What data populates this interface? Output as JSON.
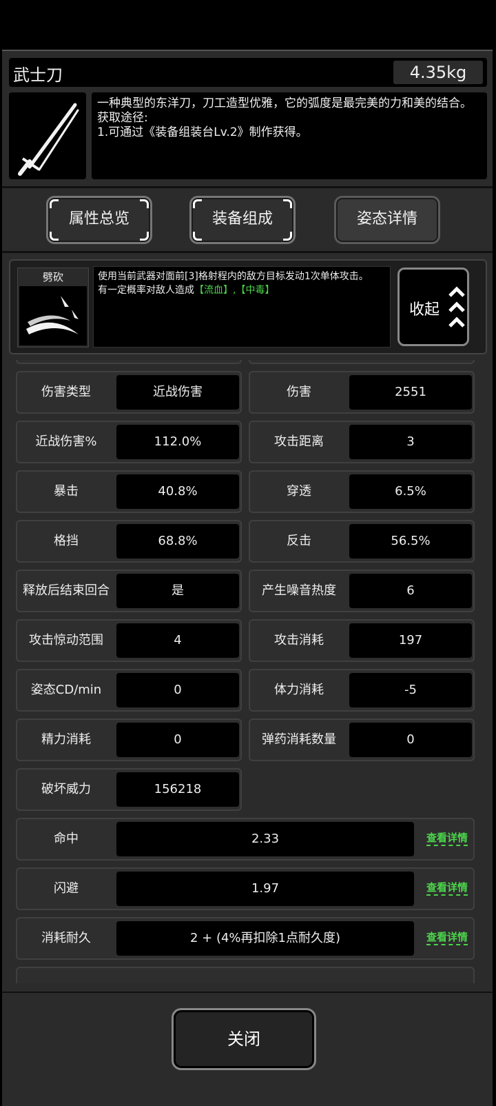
{
  "item": {
    "name": "武士刀",
    "weight": "4.35kg",
    "description_lines": [
      "一种典型的东洋刀，刀工造型优雅，它的弧度是最完美的力和美的结合。",
      "获取途径:",
      "1.可通过《装备组装台Lv.2》制作获得。"
    ]
  },
  "tabs": [
    {
      "label": "属性总览"
    },
    {
      "label": "装备组成"
    },
    {
      "label": "姿态详情"
    }
  ],
  "skill": {
    "name": "劈砍",
    "desc_line1": "使用当前武器对面前[3]格射程内的敌方目标发动1次单体攻击。",
    "desc_line2_prefix": "有一定概率对敌人造成",
    "desc_tag1": "【流血】",
    "desc_sep": ",",
    "desc_tag2": "【中毒】",
    "collapse_label": "收起"
  },
  "stats": [
    {
      "label": "伤害类型",
      "value": "近战伤害"
    },
    {
      "label": "伤害",
      "value": "2551"
    },
    {
      "label": "近战伤害%",
      "value": "112.0%"
    },
    {
      "label": "攻击距离",
      "value": "3"
    },
    {
      "label": "暴击",
      "value": "40.8%"
    },
    {
      "label": "穿透",
      "value": "6.5%"
    },
    {
      "label": "格挡",
      "value": "68.8%"
    },
    {
      "label": "反击",
      "value": "56.5%"
    },
    {
      "label": "释放后结束回合",
      "value": "是"
    },
    {
      "label": "产生噪音热度",
      "value": "6"
    },
    {
      "label": "攻击惊动范围",
      "value": "4"
    },
    {
      "label": "攻击消耗",
      "value": "197"
    },
    {
      "label": "姿态CD/min",
      "value": "0"
    },
    {
      "label": "体力消耗",
      "value": "-5"
    },
    {
      "label": "精力消耗",
      "value": "0"
    },
    {
      "label": "弹药消耗数量",
      "value": "0"
    },
    {
      "label": "破坏威力",
      "value": "156218"
    }
  ],
  "wide_stats": [
    {
      "label": "命中",
      "value": "2.33",
      "link": "查看详情"
    },
    {
      "label": "闪避",
      "value": "1.97",
      "link": "查看详情"
    },
    {
      "label": "消耗耐久",
      "value": "2 + (4%再扣除1点耐久度)",
      "link": "查看详情"
    }
  ],
  "close_label": "关闭",
  "colors": {
    "accent_green": "#4bd64b",
    "background": "#000000",
    "panel": "#2b2b2b"
  }
}
